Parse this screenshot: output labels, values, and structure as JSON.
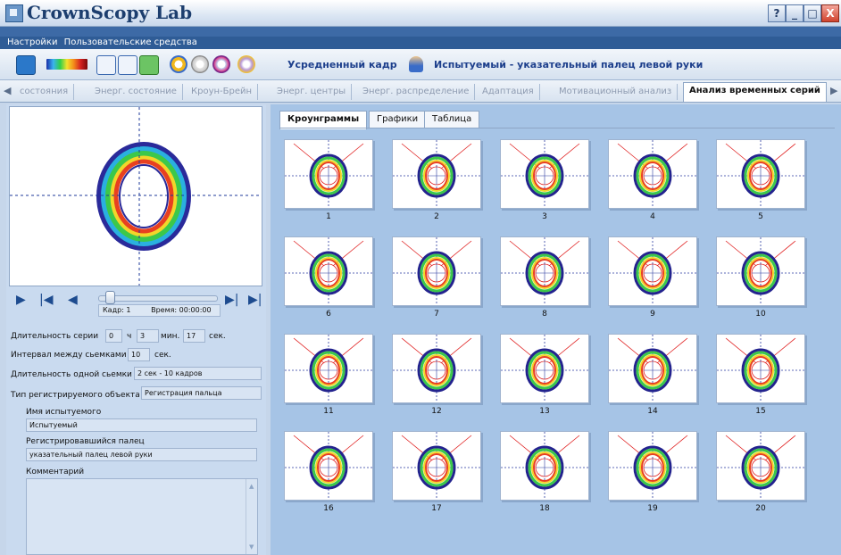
{
  "window": {
    "title": "CrownScopy Lab",
    "controls": [
      "?",
      "_",
      "□",
      "X"
    ]
  },
  "menu": [
    "Настройки",
    "Пользовательские средства"
  ],
  "toolbar": {
    "frame_label": "Усредненный кадр",
    "subject_label": "Испытуемый - указательный палец левой руки"
  },
  "tabs": [
    {
      "label": "состояния",
      "active": false
    },
    {
      "label": "Энерг. состояние",
      "active": false
    },
    {
      "label": "Кроун-Брейн",
      "active": false
    },
    {
      "label": "Энерг. центры",
      "active": false
    },
    {
      "label": "Энерг. распределение",
      "active": false
    },
    {
      "label": "Адаптация",
      "active": false
    },
    {
      "label": "Мотивационный анализ",
      "active": false
    },
    {
      "label": "Анализ временных серий",
      "active": true
    }
  ],
  "player": {
    "frame_text": "Кадр: 1",
    "time_text": "Время: 00:00:00"
  },
  "form": {
    "series_duration_label": "Длительность серии",
    "hours": "0",
    "hours_unit": "ч",
    "minutes": "3",
    "minutes_unit": "мин.",
    "seconds": "17",
    "seconds_unit": "сек.",
    "interval_label": "Интервал между сьемками",
    "interval_value": "10",
    "interval_unit": "сек.",
    "shot_duration_label": "Длительность одной сьемки",
    "shot_duration_value": "2 сек - 10 кадров",
    "object_type_label": "Тип регистрируемого объекта",
    "object_type_value": "Регистрация пальца",
    "subject_name_label": "Имя испытуемого",
    "subject_name_value": "Испытуемый",
    "finger_label": "Регистрировавшийся палец",
    "finger_value": "указательный палец левой руки",
    "comment_label": "Комментарий"
  },
  "subtabs": [
    {
      "label": "Кроунграммы",
      "active": true
    },
    {
      "label": "Графики",
      "active": false
    },
    {
      "label": "Таблица",
      "active": false
    }
  ],
  "thumbnails": [
    "1",
    "2",
    "3",
    "4",
    "5",
    "6",
    "7",
    "8",
    "9",
    "10",
    "11",
    "12",
    "13",
    "14",
    "15",
    "16",
    "17",
    "18",
    "19",
    "20"
  ]
}
